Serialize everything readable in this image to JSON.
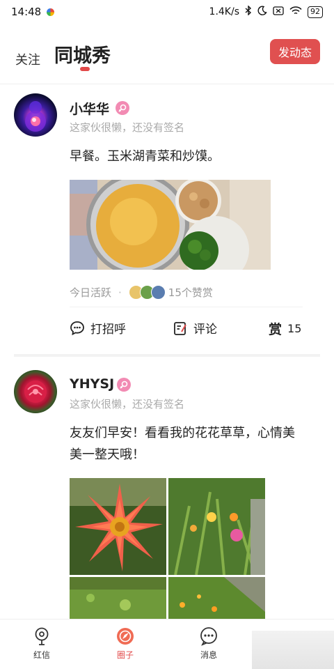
{
  "status_bar": {
    "time": "14:48",
    "network_speed": "1.4K/s",
    "battery": "92"
  },
  "header": {
    "tab_follow": "关注",
    "tab_city": "同城秀",
    "post_button": "发动态"
  },
  "posts": [
    {
      "user_name": "小华华",
      "signature": "这家伙很懒，还没有签名",
      "text": "早餐。玉米湖青菜和炒馍。",
      "activity": "今日活跃",
      "likes_text": "15个赞赏",
      "greet_label": "打招呼",
      "comment_label": "评论",
      "reward_label": "赏",
      "reward_count": "15"
    },
    {
      "user_name": "YHYSJ",
      "signature": "这家伙很懒，还没有签名",
      "text": "友友们早安！看看我的花花草草，心情美美一整天哦！"
    }
  ],
  "bottom_nav": [
    {
      "label": "红信",
      "icon": "location-pin-icon"
    },
    {
      "label": "圈子",
      "icon": "compass-icon"
    },
    {
      "label": "消息",
      "icon": "chat-bubble-icon"
    }
  ],
  "colors": {
    "accent": "#e24a4a",
    "female_badge": "#f28bb3",
    "muted_text": "#aaaaaa"
  }
}
